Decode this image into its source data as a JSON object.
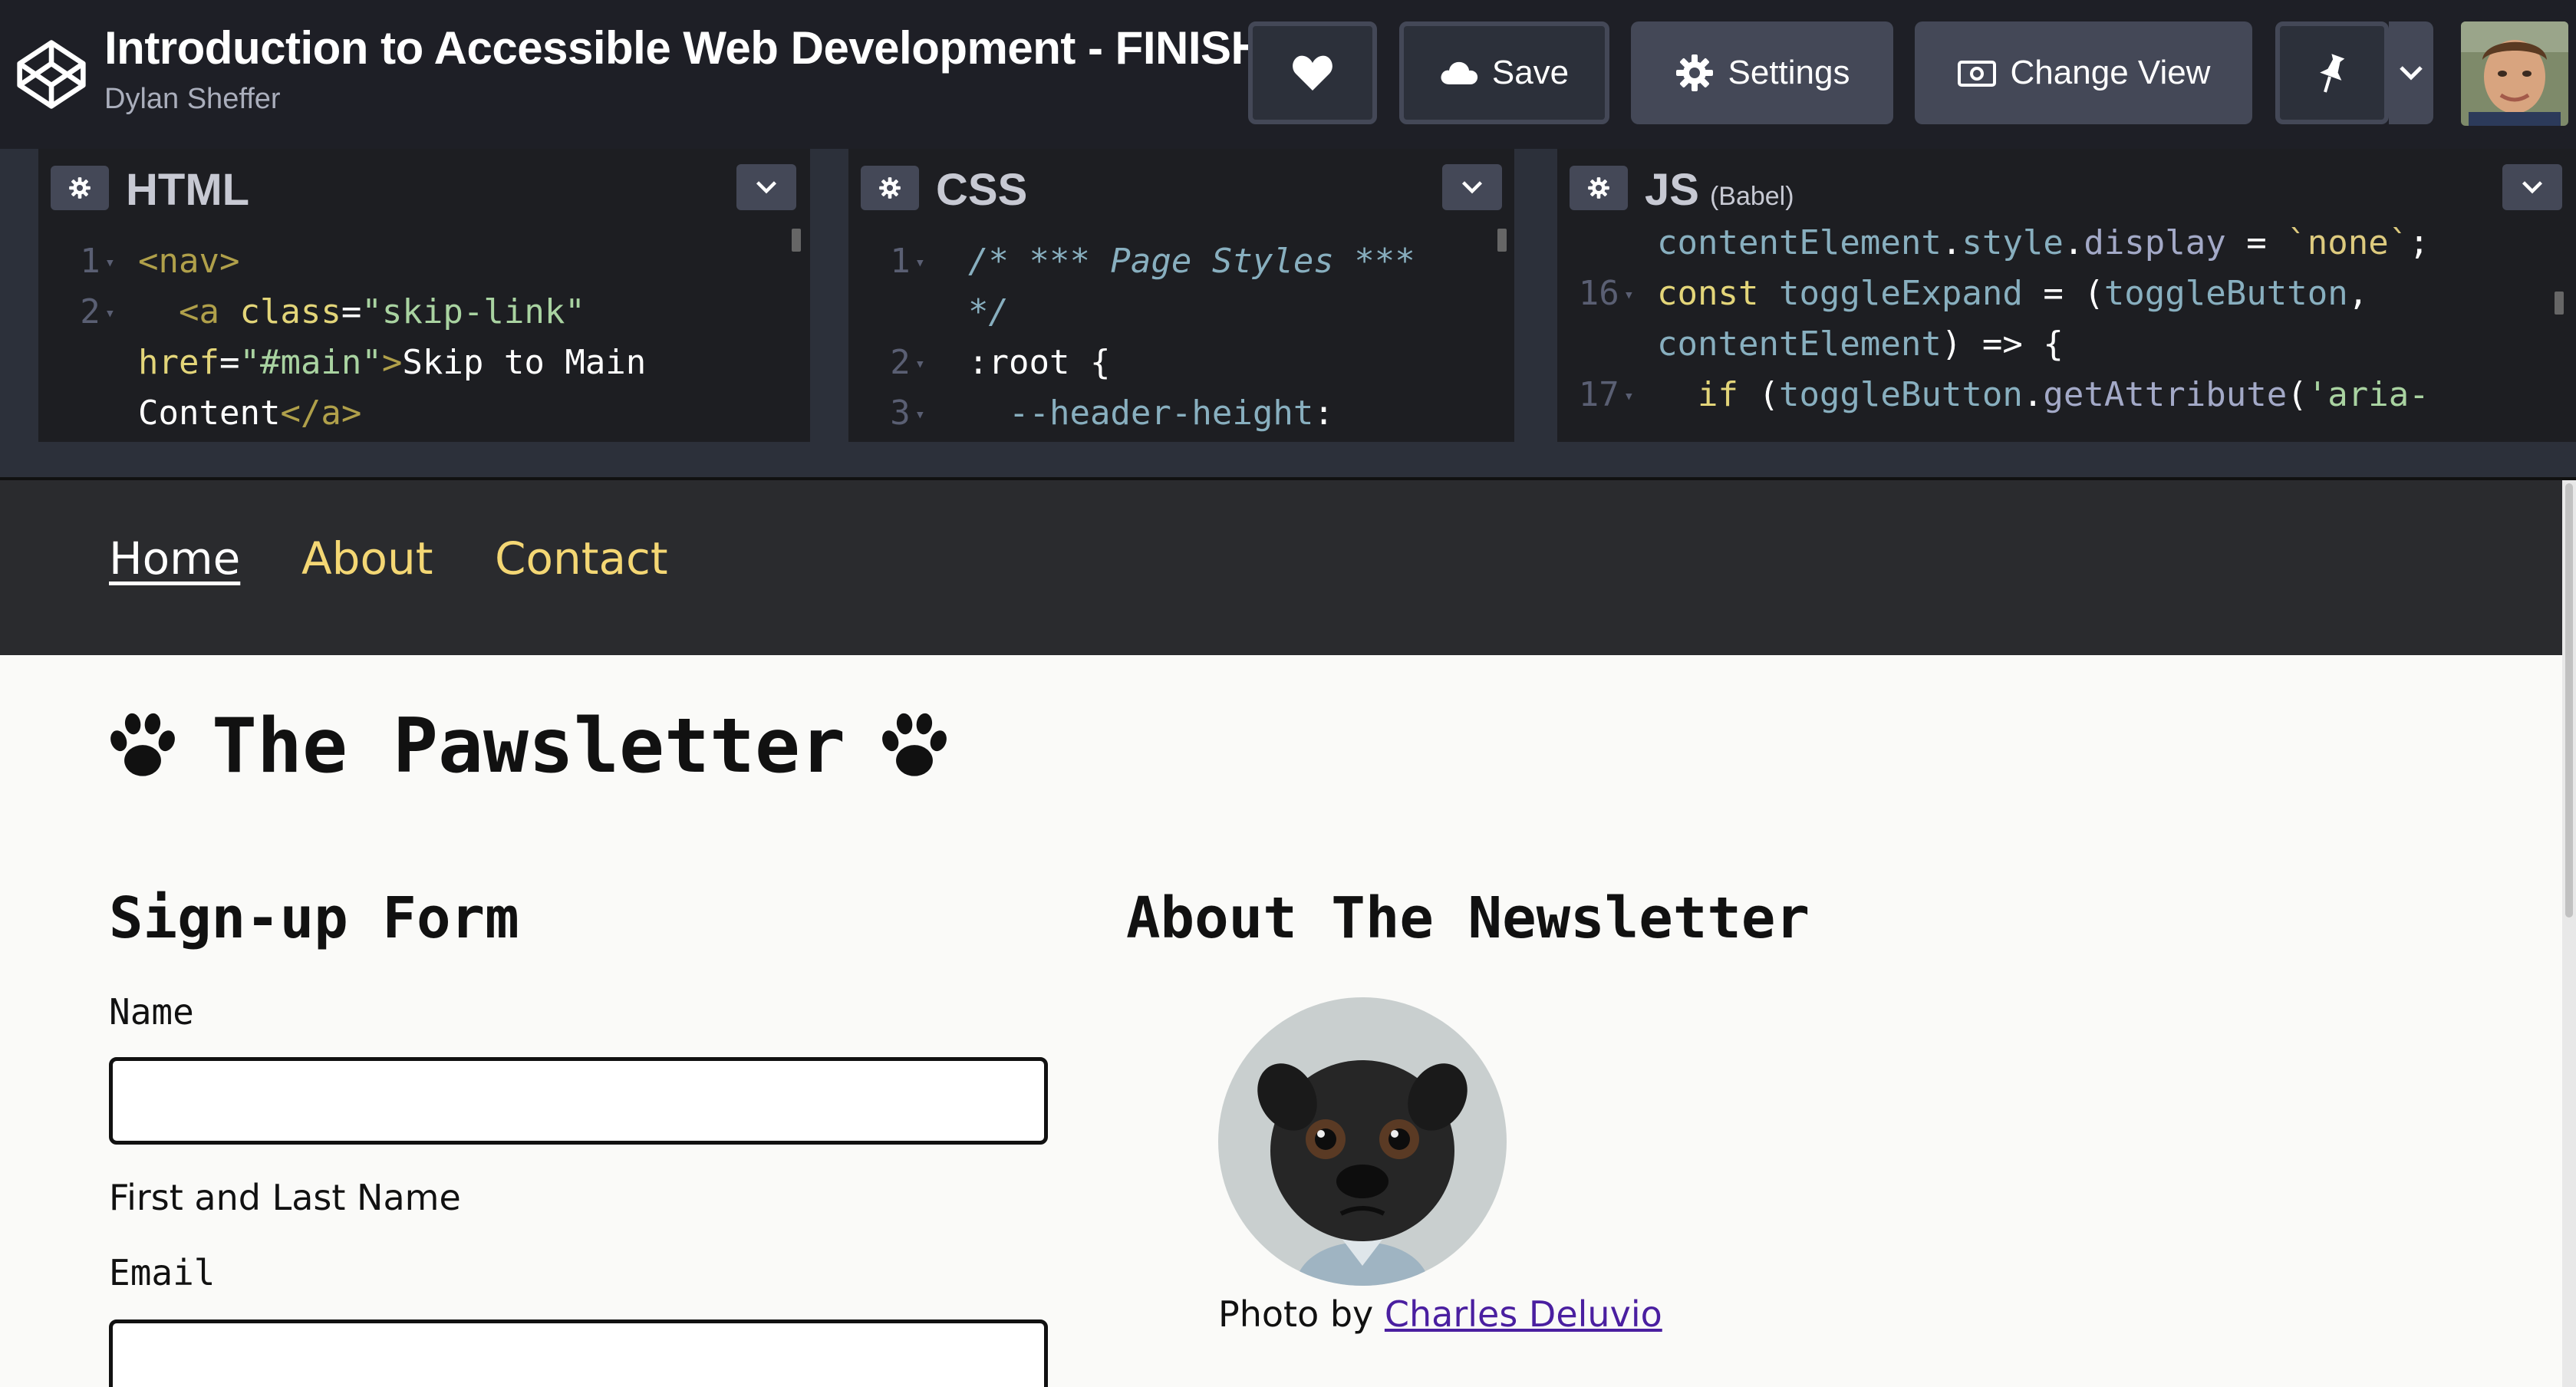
{
  "app": {
    "title": "Introduction to Accessible Web Development - FINISH",
    "author": "Dylan Sheffer",
    "buttons": {
      "save": "Save",
      "settings": "Settings",
      "change_view": "Change View"
    }
  },
  "editors": {
    "html": {
      "label": "HTML",
      "line_numbers": [
        "1",
        "2"
      ],
      "lines": [
        {
          "parts": [
            {
              "c": "tag",
              "t": "<nav>"
            }
          ]
        },
        {
          "parts": [
            {
              "c": "tag",
              "t": "  <a "
            },
            {
              "c": "attr",
              "t": "class"
            },
            {
              "c": "sel",
              "t": "="
            },
            {
              "c": "str",
              "t": "\"skip-link\""
            }
          ]
        },
        {
          "parts": [
            {
              "c": "attr",
              "t": "href"
            },
            {
              "c": "sel",
              "t": "="
            },
            {
              "c": "str",
              "t": "\"#main\""
            },
            {
              "c": "tag",
              "t": ">"
            },
            {
              "c": "sel",
              "t": "Skip to Main"
            }
          ]
        },
        {
          "parts": [
            {
              "c": "sel",
              "t": "Content"
            },
            {
              "c": "tag",
              "t": "</a>"
            }
          ]
        }
      ]
    },
    "css": {
      "label": "CSS",
      "line_numbers": [
        "1",
        "",
        "2",
        "3"
      ],
      "lines": [
        {
          "parts": [
            {
              "c": "cmt",
              "t": "/* *** Page Styles ***"
            }
          ]
        },
        {
          "parts": [
            {
              "c": "cmt",
              "t": "*/"
            }
          ]
        },
        {
          "parts": [
            {
              "c": "sel",
              "t": ":root {"
            }
          ]
        },
        {
          "parts": [
            {
              "c": "prop",
              "t": "  --header-height"
            },
            {
              "c": "sel",
              "t": ":"
            }
          ]
        }
      ]
    },
    "js": {
      "label": "JS",
      "sublabel": "(Babel)",
      "line_numbers": [
        "",
        "16",
        "",
        "17"
      ],
      "lines": [
        {
          "parts": [
            {
              "c": "var",
              "t": "contentElement"
            },
            {
              "c": "sel",
              "t": "."
            },
            {
              "c": "var",
              "t": "style"
            },
            {
              "c": "sel",
              "t": "."
            },
            {
              "c": "fn",
              "t": "display"
            },
            {
              "c": "sel",
              "t": " = "
            },
            {
              "c": "tpl",
              "t": "`none`"
            },
            {
              "c": "sel",
              "t": ";"
            }
          ]
        },
        {
          "parts": [
            {
              "c": "kw",
              "t": "const "
            },
            {
              "c": "var",
              "t": "toggleExpand"
            },
            {
              "c": "sel",
              "t": " = ("
            },
            {
              "c": "var",
              "t": "toggleButton"
            },
            {
              "c": "sel",
              "t": ","
            }
          ]
        },
        {
          "parts": [
            {
              "c": "var",
              "t": "contentElement"
            },
            {
              "c": "sel",
              "t": ") => {"
            }
          ]
        },
        {
          "parts": [
            {
              "c": "kw",
              "t": "  if "
            },
            {
              "c": "sel",
              "t": "("
            },
            {
              "c": "var",
              "t": "toggleButton"
            },
            {
              "c": "sel",
              "t": "."
            },
            {
              "c": "fn",
              "t": "getAttribute"
            },
            {
              "c": "sel",
              "t": "("
            },
            {
              "c": "str",
              "t": "'aria-"
            }
          ]
        }
      ]
    }
  },
  "preview": {
    "nav": [
      "Home",
      "About",
      "Contact"
    ],
    "heading": "The Pawsletter",
    "form": {
      "title": "Sign-up Form",
      "name_label": "Name",
      "name_value": "",
      "name_hint": "First and Last Name",
      "email_label": "Email",
      "email_value": ""
    },
    "about": {
      "title": "About The Newsletter",
      "credit_prefix": "Photo by",
      "credit_link": "Charles Deluvio"
    }
  },
  "colors": {
    "accent_link": "#f4d774",
    "nav_bg": "#2a2b2e",
    "credit_link": "#4a1fa0"
  }
}
